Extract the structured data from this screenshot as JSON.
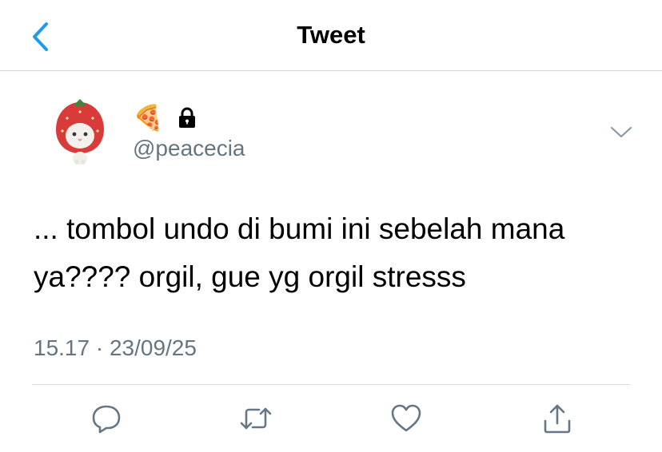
{
  "header": {
    "title": "Tweet"
  },
  "tweet": {
    "display_name_emoji": "🍕",
    "handle": "@peacecia",
    "text": "... tombol undo di bumi ini sebelah mana ya???? orgil, gue yg orgil stresss",
    "timestamp": "15.17 · 23/09/25"
  },
  "icons": {
    "back": "chevron-left-icon",
    "lock": "lock-icon",
    "menu": "chevron-down-icon",
    "reply": "reply-icon",
    "retweet": "retweet-icon",
    "like": "heart-icon",
    "share": "share-icon"
  },
  "colors": {
    "accent": "#1d9bf0",
    "secondary_text": "#66757f",
    "icon_gray": "#657786"
  }
}
